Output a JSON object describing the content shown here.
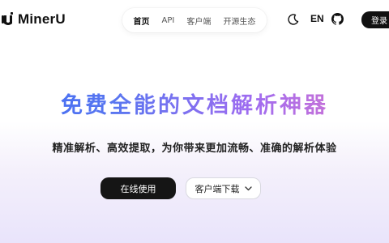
{
  "brand": {
    "name": "MinerU"
  },
  "nav": {
    "items": [
      {
        "label": "首页",
        "active": true
      },
      {
        "label": "API",
        "active": false
      },
      {
        "label": "客户端",
        "active": false
      },
      {
        "label": "开源生态",
        "active": false
      }
    ]
  },
  "header": {
    "lang_label": "EN",
    "login_label": "登录",
    "icons": [
      "moon-icon",
      "github-icon"
    ]
  },
  "hero": {
    "title": "免费全能的文档解析神器",
    "subtitle": "精准解析、高效提取，为你带来更加流畅、准确的解析体验",
    "primary_button": "在线使用",
    "secondary_button": "客户端下载"
  },
  "colors": {
    "title_gradient": [
      "#3b6cf4",
      "#a06cf0",
      "#e076c8"
    ],
    "primary_button": "#151515"
  }
}
